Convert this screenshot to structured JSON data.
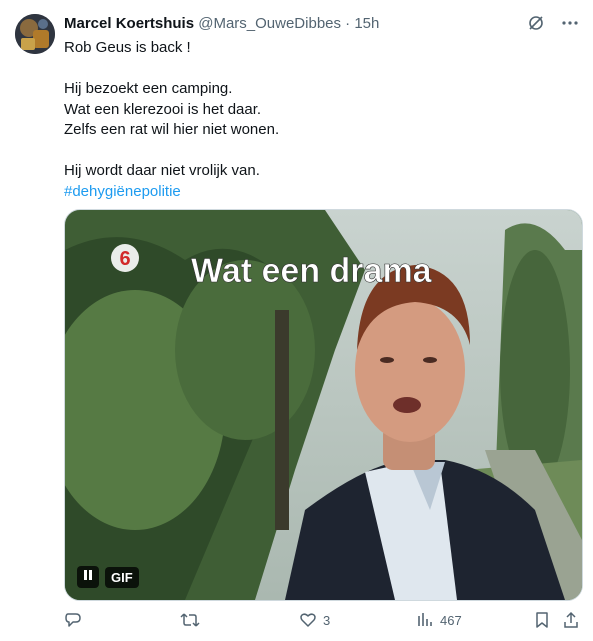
{
  "author": {
    "display_name": "Marcel Koertshuis",
    "handle": "@Mars_OuweDibbes",
    "separator": "·",
    "time": "15h"
  },
  "tweet": {
    "lines": [
      "Rob Geus is back !",
      "",
      "Hij bezoekt een camping.",
      "Wat een klerezooi is het daar.",
      "Zelfs een rat wil hier niet wonen.",
      "",
      "Hij wordt daar niet vrolijk van."
    ],
    "hashtag": "#dehygiënepolitie"
  },
  "media": {
    "overlay_text": "Wat een drama",
    "channel_logo": "6",
    "gif_label": "GIF"
  },
  "actions": {
    "reply_count": "",
    "retweet_count": "",
    "like_count": "3",
    "views_count": "467"
  },
  "icons": [
    "grok-icon",
    "more-icon",
    "reply-icon",
    "retweet-icon",
    "like-icon",
    "views-icon",
    "bookmark-icon",
    "share-icon",
    "pause-icon"
  ],
  "colors": {
    "link": "#1d9bf0",
    "secondary_text": "#536471",
    "primary_text": "#0f1419"
  }
}
